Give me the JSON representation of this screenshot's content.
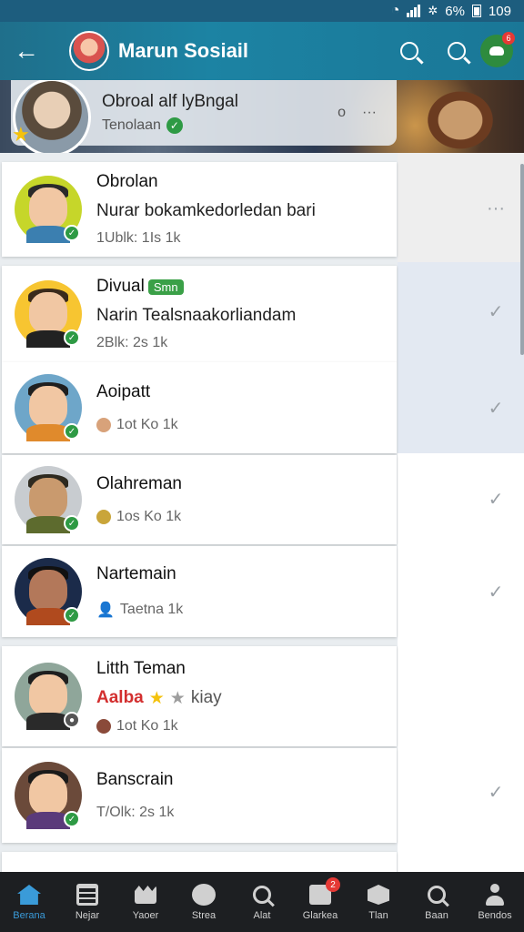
{
  "status_bar": {
    "battery_text": "6%",
    "time": "109"
  },
  "app_bar": {
    "title": "Marun Sosiail",
    "back_icon": "arrow-left-icon",
    "notification_badge": "6"
  },
  "banner": {
    "title": "Obroal alf lyBngal",
    "subtitle": "Tenolaan",
    "action_1": "o",
    "action_2": "···"
  },
  "chats": [
    {
      "name": "Obrolan",
      "message": "Nurar bokamkedorledan bari",
      "meta": "1Ublk: 1Is 1k",
      "action": "···",
      "avatar_bg": "#c6d62a",
      "status_color": "#2e9a44"
    },
    {
      "name": "Divual",
      "tag": "Smn",
      "message": "Narin Tealsnaakorliandam",
      "meta": "2Blk: 2s 1k",
      "action": "✓",
      "avatar_bg": "#f7c531",
      "status_color": "#2e9a44"
    },
    {
      "name": "Aoipatt",
      "meta": "1ot Ko 1k",
      "action": "✓",
      "avatar_bg": "#6ea6c9",
      "status_color": "#2e9a44"
    },
    {
      "name": "Olahreman",
      "meta": "1os Ko 1k",
      "action": "✓",
      "avatar_bg": "#c8ccd0",
      "status_color": "#2e9a44"
    },
    {
      "name": "Nartemain",
      "meta": "Taetna 1k",
      "action": "✓",
      "avatar_bg": "#1b2b4a",
      "status_color": "#2e9a44"
    },
    {
      "name": "Litth Teman",
      "rating_label": "Aalba",
      "rating_note": "kiay",
      "meta": "1ot Ko 1k",
      "avatar_bg": "#8fa69a",
      "status_color": "#555555"
    },
    {
      "name": "Banscrain",
      "meta": "T/Olk: 2s 1k",
      "action": "✓",
      "avatar_bg": "#6b4a3a",
      "status_color": "#2e9a44"
    }
  ],
  "bottom_nav": [
    {
      "label": "Berana",
      "icon": "home-icon",
      "active": true
    },
    {
      "label": "Nejar",
      "icon": "grid-icon"
    },
    {
      "label": "Yaoer",
      "icon": "bag-icon"
    },
    {
      "label": "Strea",
      "icon": "chat-bubble-icon"
    },
    {
      "label": "Alat",
      "icon": "search-icon"
    },
    {
      "label": "Glarkea",
      "icon": "gift-icon",
      "badge": "2"
    },
    {
      "label": "Tlan",
      "icon": "box-icon"
    },
    {
      "label": "Baan",
      "icon": "search-icon"
    },
    {
      "label": "Bendos",
      "icon": "user-icon"
    }
  ],
  "colors": {
    "appbar": "#1c83a3",
    "accent": "#3a9bd9",
    "online": "#2e9a44",
    "nav_bg": "#1d1f22"
  }
}
